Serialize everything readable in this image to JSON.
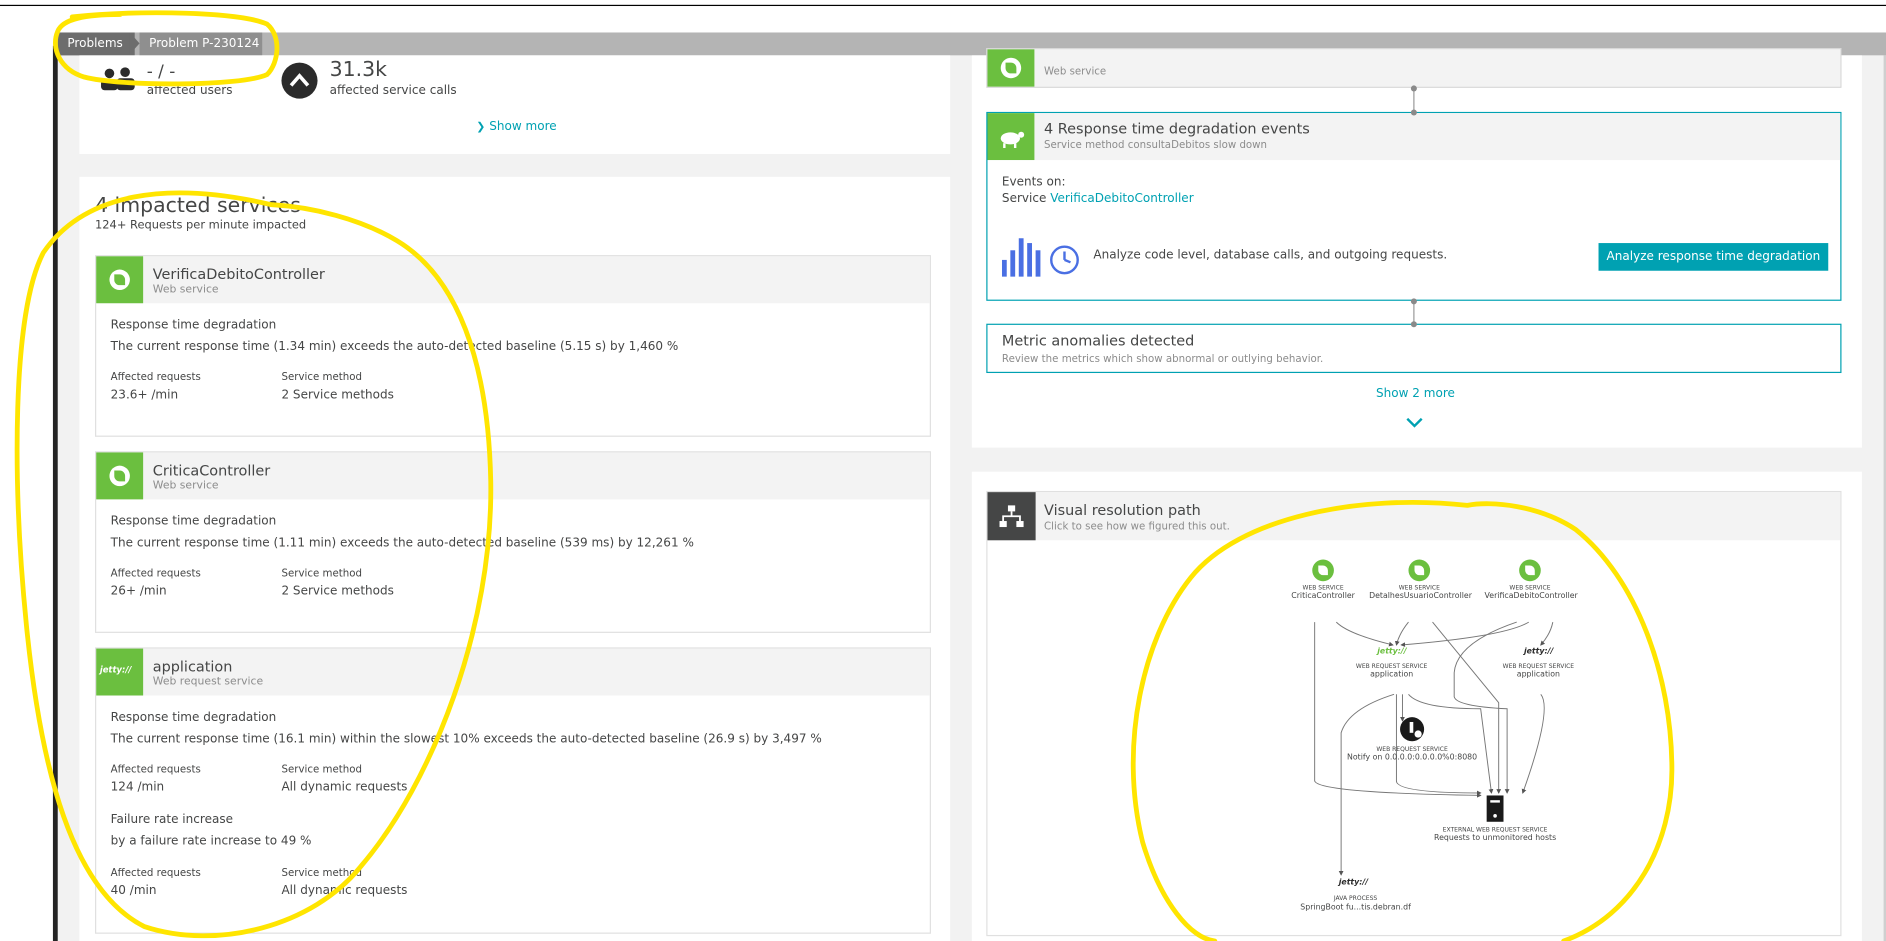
{
  "breadcrumb": {
    "problems": "Problems",
    "current": "Problem P-230124"
  },
  "summary": {
    "users_value": "- / -",
    "users_label": "affected users",
    "calls_value": "31.3k",
    "calls_label": "affected service calls",
    "show_more": "Show more"
  },
  "impacted": {
    "title": "4 impacted services",
    "subtitle": "124+ Requests per minute impacted",
    "services": [
      {
        "name": "VerificaDebitoController",
        "type": "Web service",
        "issue": "Response time degradation",
        "detail": "The current response time (1.34 min) exceeds the auto-detected baseline (5.15 s) by 1,460 %",
        "req_label": "Affected requests",
        "req_value": "23.6+ /min",
        "method_label": "Service method",
        "method_value": "2 Service methods"
      },
      {
        "name": "CriticaController",
        "type": "Web service",
        "issue": "Response time degradation",
        "detail": "The current response time (1.11 min) exceeds the auto-detected baseline (539 ms) by 12,261 %",
        "req_label": "Affected requests",
        "req_value": "26+ /min",
        "method_label": "Service method",
        "method_value": "2 Service methods"
      },
      {
        "name": "application",
        "type": "Web request service",
        "icon_text": "jetty://",
        "issue": "Response time degradation",
        "detail": "The current response time (16.1 min) within the slowest 10% exceeds the auto-detected baseline (26.9 s) by 3,497 %",
        "req_label": "Affected requests",
        "req_value": "124 /min",
        "method_label": "Service method",
        "method_value": "All dynamic requests",
        "issue2": "Failure rate increase",
        "detail2": "by a failure rate increase to 49 %",
        "req_label2": "Affected requests",
        "req_value2": "40 /min",
        "method_label2": "Service method",
        "method_value2": "All dynamic requests"
      }
    ]
  },
  "events": {
    "prev_sub": "Web service",
    "degradation_title": "4 Response time degradation events",
    "degradation_sub": "Service method consultaDebitos slow down",
    "events_on": "Events on:",
    "service_prefix": "Service",
    "service_link": "VerificaDebitoController",
    "analyze_text": "Analyze code level, database calls, and outgoing requests.",
    "analyze_button": "Analyze response time degradation",
    "metric_title": "Metric anomalies detected",
    "metric_sub": "Review the metrics which show abnormal or outlying behavior.",
    "show2": "Show 2 more"
  },
  "vrp": {
    "title": "Visual resolution path",
    "subtitle": "Click to see how we figured this out.",
    "nodes": {
      "ws_label": "WEB SERVICE",
      "ws1": "CriticaController",
      "ws2": "DetalhesUsuarioController",
      "ws3": "VerificaDebitoController",
      "wrs_label": "WEB REQUEST SERVICE",
      "jetty": "jetty://",
      "app1": "application",
      "app2": "application",
      "notify_label": "WEB REQUEST SERVICE",
      "notify": "Notify on 0.0.0.0:0.0.0.0%0:8080",
      "ext_label": "EXTERNAL WEB REQUEST SERVICE",
      "ext": "Requests to unmonitored hosts",
      "proc_label": "JAVA PROCESS",
      "proc": "SpringBoot fu...tis.debran.df"
    }
  },
  "colors": {
    "accent": "#00a1b2",
    "spring_green": "#6bbf3f",
    "annotation_yellow": "#ffe500"
  }
}
